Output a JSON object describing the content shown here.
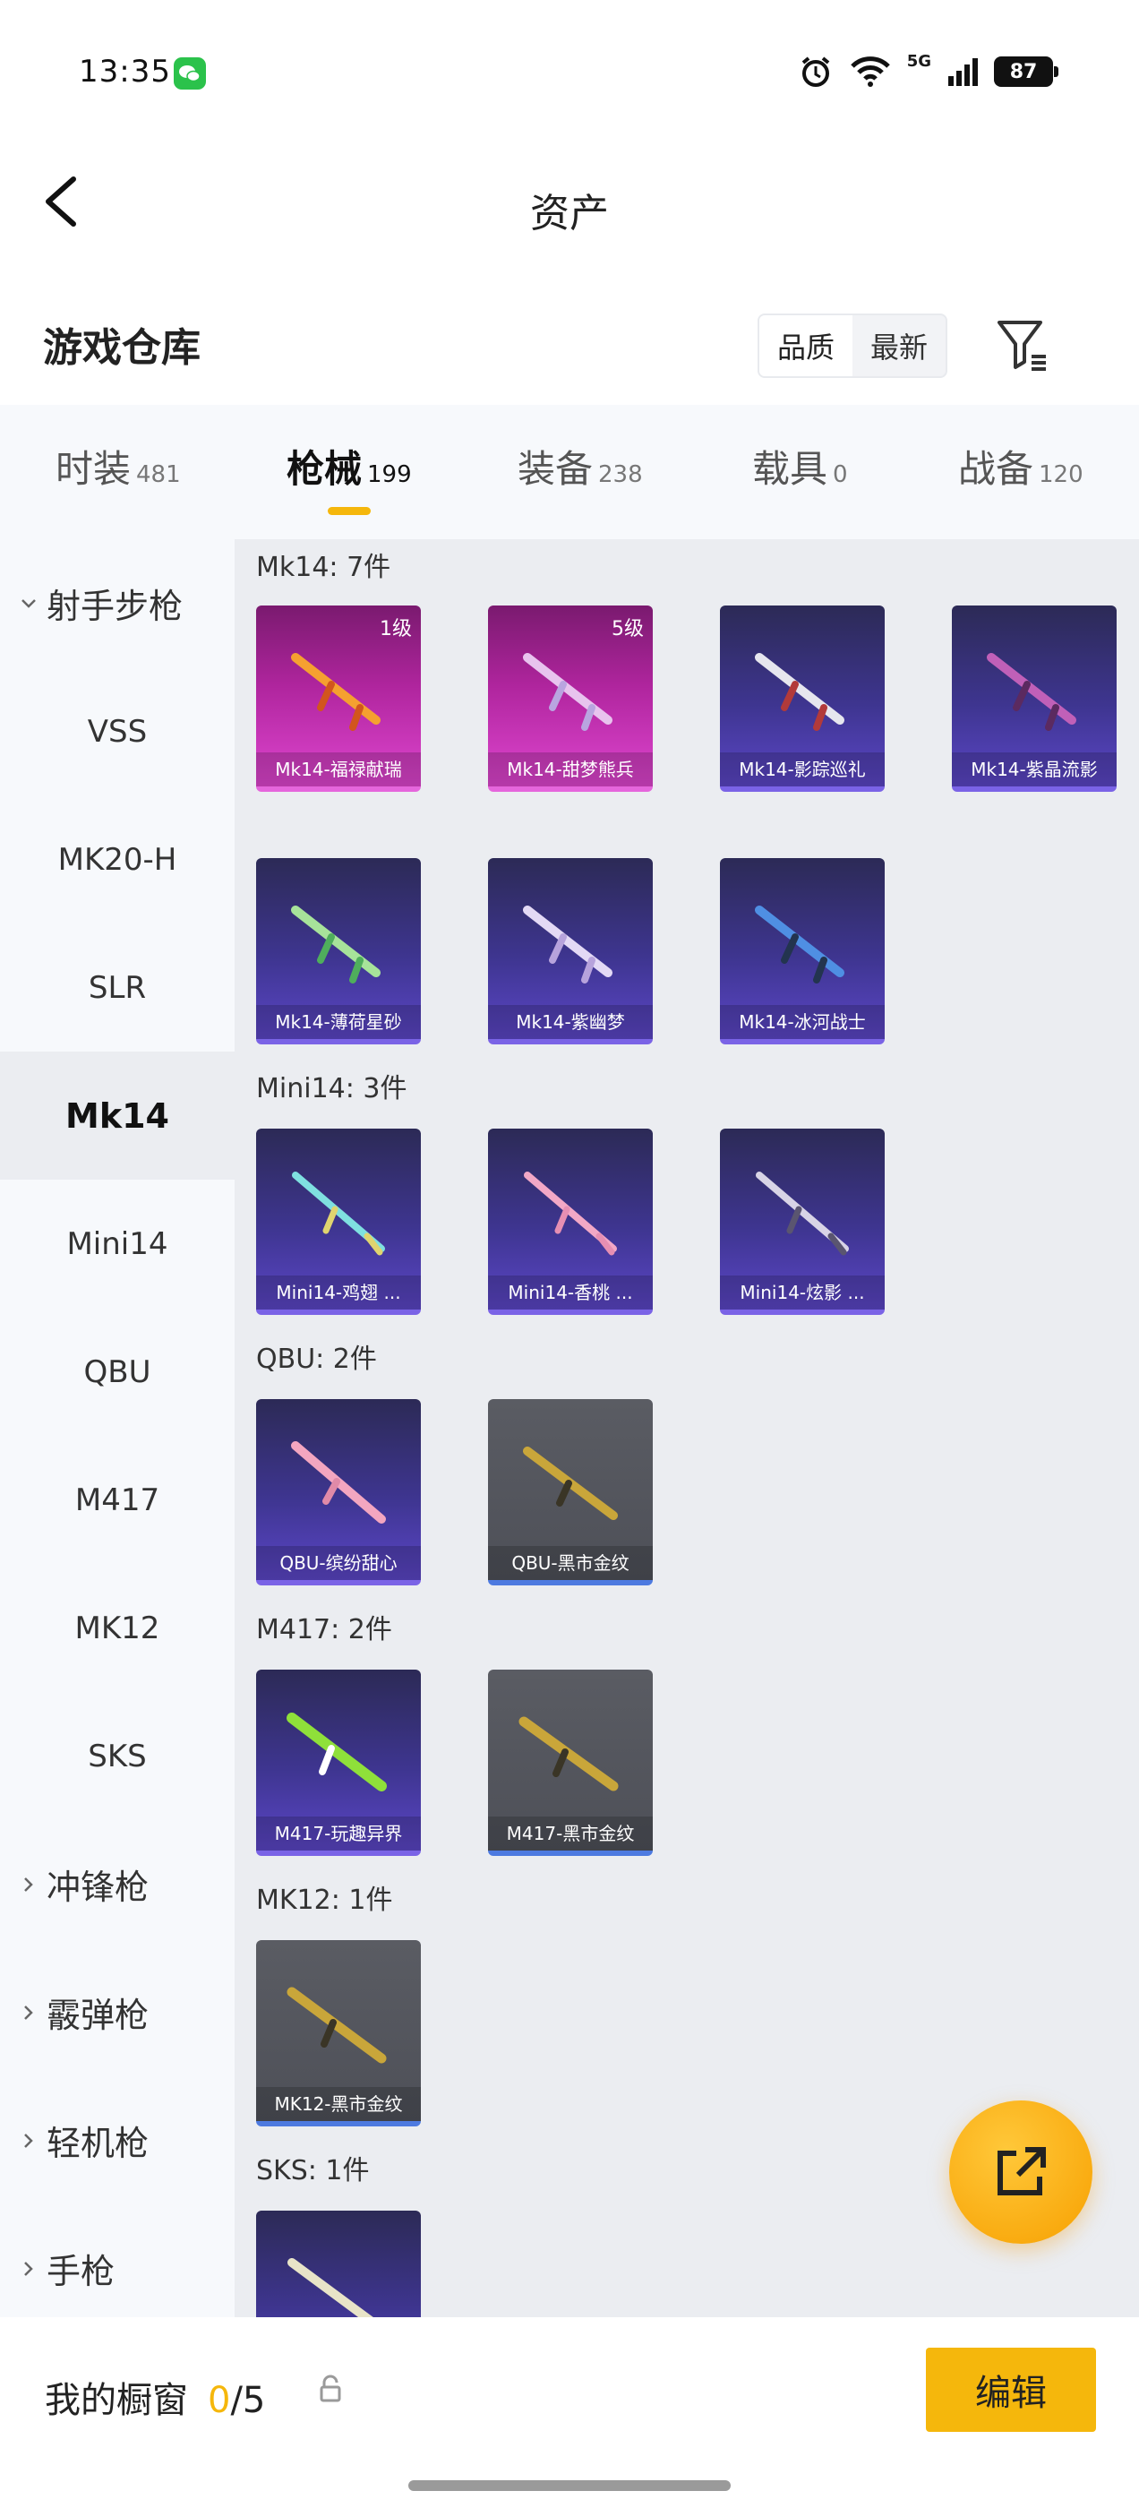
{
  "status_bar": {
    "time": "13:35",
    "network": "5G",
    "battery": "87"
  },
  "nav": {
    "title": "资产"
  },
  "warehouse": {
    "title": "游戏仓库",
    "sort_options": [
      "品质",
      "最新"
    ],
    "sort_active": "品质"
  },
  "tabs": [
    {
      "label": "时装",
      "count": "481"
    },
    {
      "label": "枪械",
      "count": "199",
      "active": true
    },
    {
      "label": "装备",
      "count": "238"
    },
    {
      "label": "载具",
      "count": "0"
    },
    {
      "label": "战备",
      "count": "120"
    }
  ],
  "sidebar": {
    "group_open": "射手步枪",
    "items": [
      "VSS",
      "MK20-H",
      "SLR",
      "Mk14",
      "Mini14",
      "QBU",
      "M417",
      "MK12",
      "SKS"
    ],
    "active": "Mk14",
    "groups_closed": [
      "冲锋枪",
      "霰弹枪",
      "轻机枪",
      "手枪"
    ]
  },
  "sections": [
    {
      "title": "Mk14: 7件",
      "cards": [
        {
          "label": "Mk14-福禄献瑞",
          "level": "1级",
          "style": "pink"
        },
        {
          "label": "Mk14-甜梦熊兵",
          "level": "5级",
          "style": "pink"
        },
        {
          "label": "Mk14-影踪巡礼",
          "style": "purple"
        },
        {
          "label": "Mk14-紫晶流影",
          "style": "purple"
        },
        {
          "label": "Mk14-薄荷星砂",
          "style": "purple"
        },
        {
          "label": "Mk14-紫幽梦",
          "style": "purple"
        },
        {
          "label": "Mk14-冰河战士",
          "style": "purple"
        }
      ]
    },
    {
      "title": "Mini14: 3件",
      "cards": [
        {
          "label": "Mini14-鸡翅 ...",
          "style": "purple"
        },
        {
          "label": "Mini14-香桃 ...",
          "style": "purple"
        },
        {
          "label": "Mini14-炫影 ...",
          "style": "purple"
        }
      ]
    },
    {
      "title": "QBU: 2件",
      "cards": [
        {
          "label": "QBU-缤纷甜心",
          "style": "purple"
        },
        {
          "label": "QBU-黑市金纹",
          "style": "gray"
        }
      ]
    },
    {
      "title": "M417: 2件",
      "cards": [
        {
          "label": "M417-玩趣异界",
          "style": "purple"
        },
        {
          "label": "M417-黑市金纹",
          "style": "gray"
        }
      ]
    },
    {
      "title": "MK12: 1件",
      "cards": [
        {
          "label": "MK12-黑市金纹",
          "style": "gray"
        }
      ]
    },
    {
      "title": "SKS: 1件",
      "cards": [
        {
          "label": "",
          "style": "purple"
        }
      ]
    }
  ],
  "showcase": {
    "label": "我的橱窗",
    "current": "0",
    "total": "/5"
  },
  "edit_button": "编辑",
  "colors": {
    "accent": "#f5b70c",
    "card_purple": "#3e3590",
    "card_pink": "#b0259e",
    "card_gray": "#52545b"
  }
}
